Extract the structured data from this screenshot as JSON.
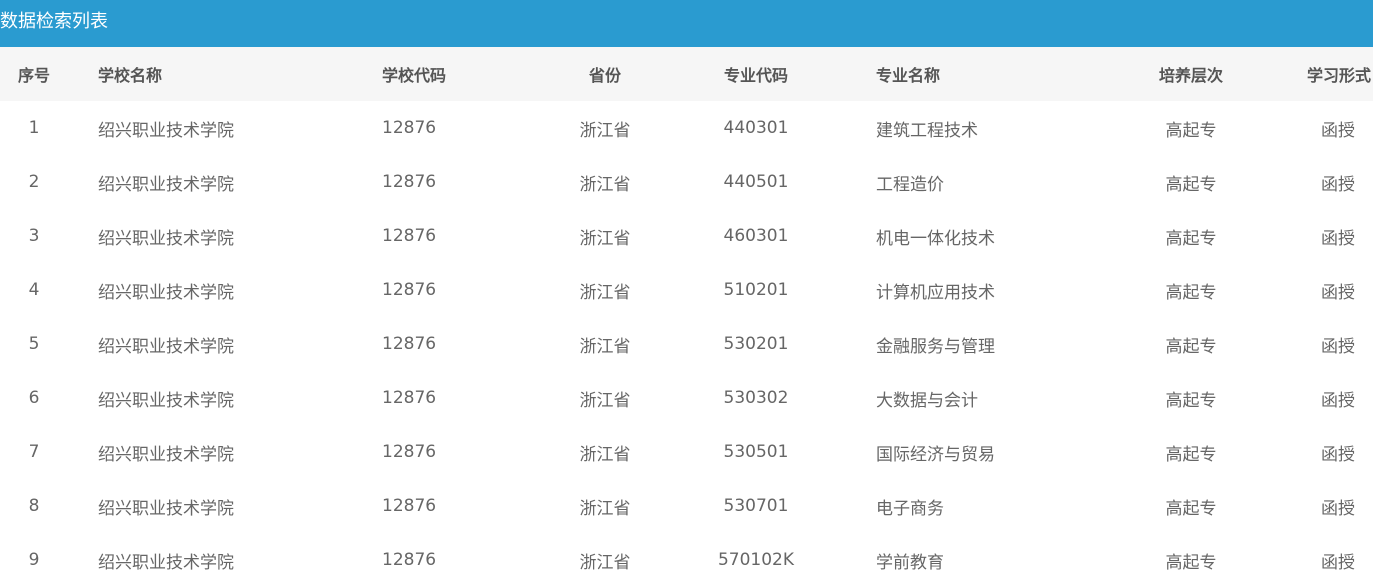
{
  "panel": {
    "title": "数据检索列表"
  },
  "table": {
    "headers": {
      "index": "序号",
      "school_name": "学校名称",
      "school_code": "学校代码",
      "province": "省份",
      "major_code": "专业代码",
      "major_name": "专业名称",
      "level": "培养层次",
      "study_form": "学习形式"
    },
    "rows": [
      {
        "index": "1",
        "school_name": "绍兴职业技术学院",
        "school_code": "12876",
        "province": "浙江省",
        "major_code": "440301",
        "major_name": "建筑工程技术",
        "level": "高起专",
        "study_form": "函授"
      },
      {
        "index": "2",
        "school_name": "绍兴职业技术学院",
        "school_code": "12876",
        "province": "浙江省",
        "major_code": "440501",
        "major_name": "工程造价",
        "level": "高起专",
        "study_form": "函授"
      },
      {
        "index": "3",
        "school_name": "绍兴职业技术学院",
        "school_code": "12876",
        "province": "浙江省",
        "major_code": "460301",
        "major_name": "机电一体化技术",
        "level": "高起专",
        "study_form": "函授"
      },
      {
        "index": "4",
        "school_name": "绍兴职业技术学院",
        "school_code": "12876",
        "province": "浙江省",
        "major_code": "510201",
        "major_name": "计算机应用技术",
        "level": "高起专",
        "study_form": "函授"
      },
      {
        "index": "5",
        "school_name": "绍兴职业技术学院",
        "school_code": "12876",
        "province": "浙江省",
        "major_code": "530201",
        "major_name": "金融服务与管理",
        "level": "高起专",
        "study_form": "函授"
      },
      {
        "index": "6",
        "school_name": "绍兴职业技术学院",
        "school_code": "12876",
        "province": "浙江省",
        "major_code": "530302",
        "major_name": "大数据与会计",
        "level": "高起专",
        "study_form": "函授"
      },
      {
        "index": "7",
        "school_name": "绍兴职业技术学院",
        "school_code": "12876",
        "province": "浙江省",
        "major_code": "530501",
        "major_name": "国际经济与贸易",
        "level": "高起专",
        "study_form": "函授"
      },
      {
        "index": "8",
        "school_name": "绍兴职业技术学院",
        "school_code": "12876",
        "province": "浙江省",
        "major_code": "530701",
        "major_name": "电子商务",
        "level": "高起专",
        "study_form": "函授"
      },
      {
        "index": "9",
        "school_name": "绍兴职业技术学院",
        "school_code": "12876",
        "province": "浙江省",
        "major_code": "570102K",
        "major_name": "学前教育",
        "level": "高起专",
        "study_form": "函授"
      }
    ]
  },
  "colors": {
    "title_bar": "#2a9bd0",
    "header_row": "#f6f6f6"
  }
}
